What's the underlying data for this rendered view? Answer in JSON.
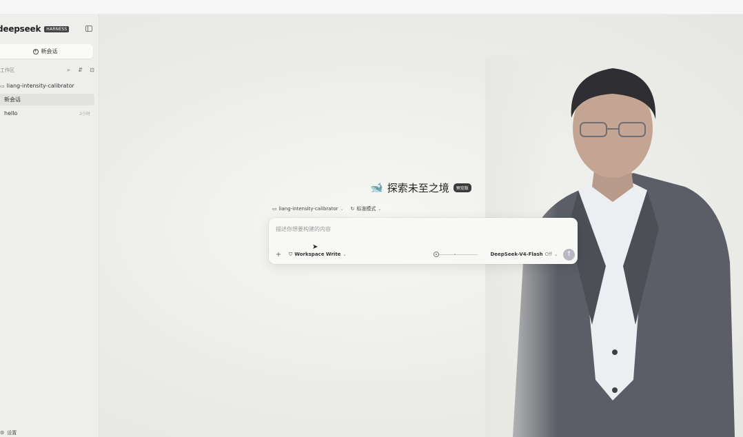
{
  "sidebar": {
    "brand": "deepseek",
    "brand_tag": "HARNESS",
    "new_chat_label": "新会话",
    "section_label": "工作区",
    "tree": [
      {
        "label": "liang-intensity-calibrator",
        "time": ""
      },
      {
        "label": "新会话",
        "time": ""
      },
      {
        "label": "hello",
        "time": "2小时"
      }
    ],
    "settings_label": "设置"
  },
  "main": {
    "hero_title": "探索未至之境",
    "hero_badge": "预览版",
    "workspace_chip": "liang-intensity-calibrator",
    "mode_chip": "标准模式",
    "composer": {
      "placeholder": "描述你想要构建的内容",
      "mode_label": "Workspace Write",
      "model_label": "DeepSeek-V4-Flash",
      "model_state": "Off"
    }
  },
  "colors": {
    "sidebar_bg": "#eeeeec",
    "main_bg": "#ecece8",
    "send_button": "#b7b8c4",
    "badge_bg": "#3a3a3a"
  },
  "icons": {
    "collapse": "sidebar-collapse-icon",
    "search": "search-icon",
    "filter": "filter-icon",
    "new_folder": "new-folder-icon",
    "folder": "folder-icon",
    "send": "arrow-up-icon"
  }
}
